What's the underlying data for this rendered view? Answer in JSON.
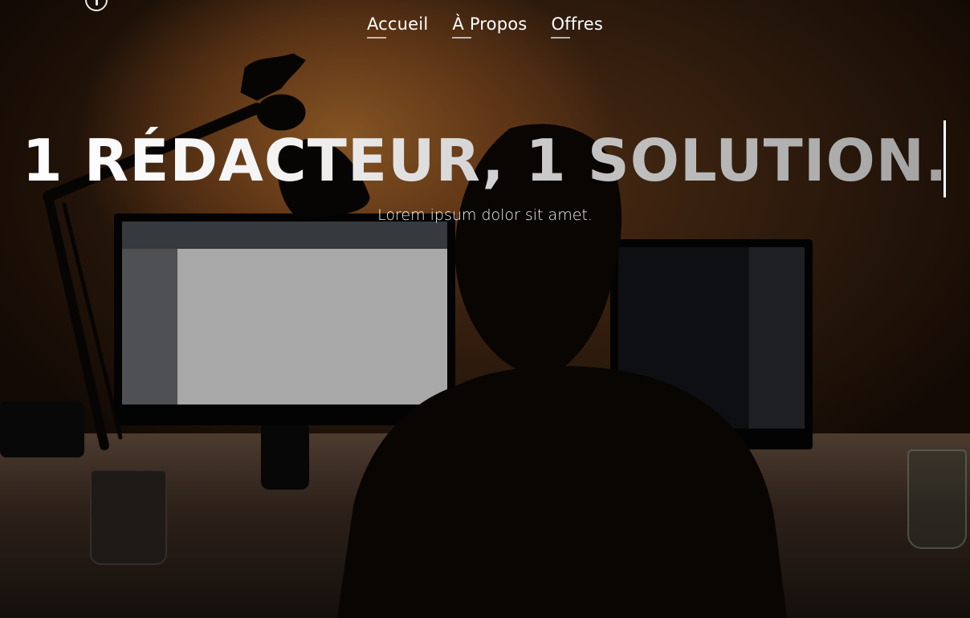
{
  "nav": {
    "items": [
      {
        "label": "Accueil"
      },
      {
        "label": "À Propos"
      },
      {
        "label": "Offres"
      }
    ]
  },
  "hero": {
    "headline": "1 RÉDACTEUR, 1 SOLUTION.",
    "subtitle": "Lorem ipsum dolor sit amet."
  },
  "colors": {
    "nav_text": "#ffffff",
    "headline_start": "#ffffff",
    "headline_end": "#a2a2a2",
    "background_warm": "#6d3f1c"
  },
  "icons": {
    "logo": "logo-icon",
    "cursor": "text-cursor-icon"
  }
}
